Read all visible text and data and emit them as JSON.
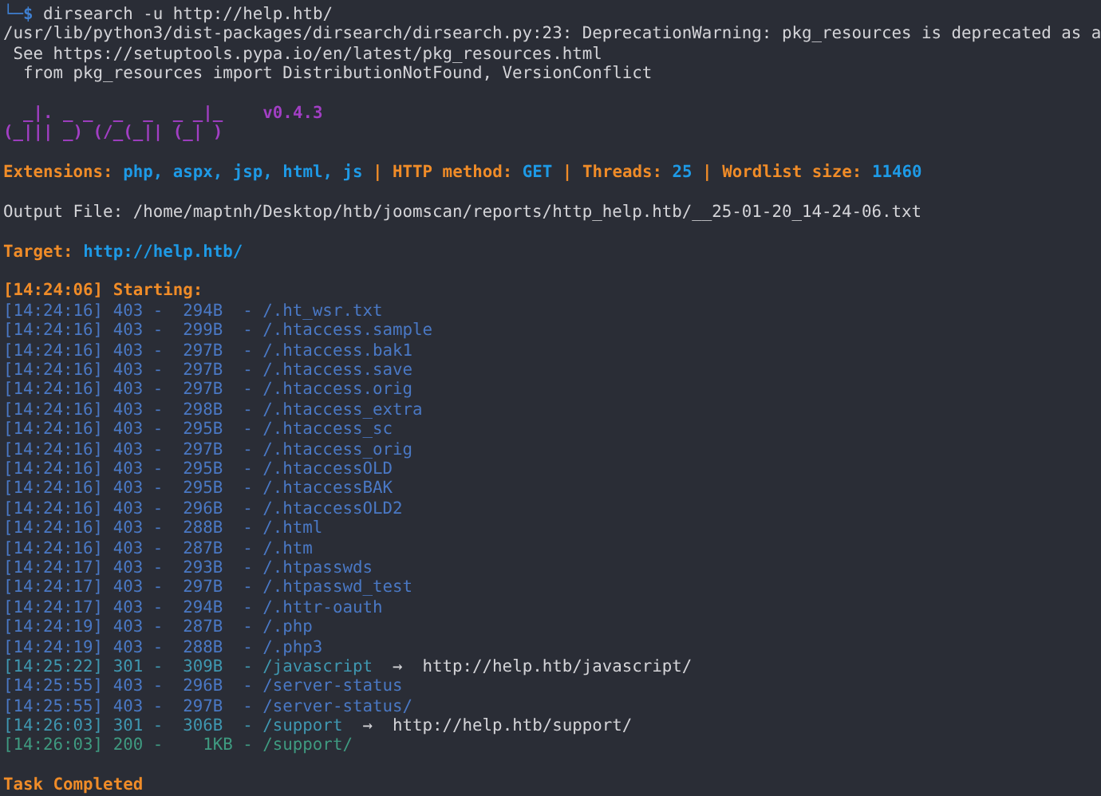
{
  "prompt": {
    "corner": "└─",
    "symbol": "$",
    "command": "dirsearch -u http://help.htb/"
  },
  "warning_lines": [
    "/usr/lib/python3/dist-packages/dirsearch/dirsearch.py:23: DeprecationWarning: pkg_resources is deprecated as a",
    " See https://setuptools.pypa.io/en/latest/pkg_resources.html",
    "  from pkg_resources import DistributionNotFound, VersionConflict"
  ],
  "banner": {
    "art": [
      "  _|. _ _  _  _  _ _|_",
      "(_||| _) (/_(_|| (_| )"
    ],
    "version": "v0.4.3"
  },
  "config": [
    {
      "kind": "label",
      "text": "Extensions:"
    },
    {
      "kind": "value",
      "text": "php, aspx, jsp, html, js"
    },
    {
      "kind": "separator",
      "text": "|"
    },
    {
      "kind": "label",
      "text": "HTTP method:"
    },
    {
      "kind": "value",
      "text": "GET"
    },
    {
      "kind": "separator",
      "text": "|"
    },
    {
      "kind": "label",
      "text": "Threads:"
    },
    {
      "kind": "value",
      "text": "25"
    },
    {
      "kind": "separator",
      "text": "|"
    },
    {
      "kind": "label",
      "text": "Wordlist size:"
    },
    {
      "kind": "value",
      "text": "11460"
    }
  ],
  "output_file": "Output File: /home/maptnh/Desktop/htb/joomscan/reports/http_help.htb/__25-01-20_14-24-06.txt",
  "target": {
    "label": "Target:",
    "value": "http://help.htb/"
  },
  "start": "[14:24:06] Starting:",
  "results": [
    {
      "line": "[14:24:16] 403 -  294B  - /.ht_wsr.txt",
      "color": "#4a78c4"
    },
    {
      "line": "[14:24:16] 403 -  299B  - /.htaccess.sample",
      "color": "#4a78c4"
    },
    {
      "line": "[14:24:16] 403 -  297B  - /.htaccess.bak1",
      "color": "#4a78c4"
    },
    {
      "line": "[14:24:16] 403 -  297B  - /.htaccess.save",
      "color": "#4a78c4"
    },
    {
      "line": "[14:24:16] 403 -  297B  - /.htaccess.orig",
      "color": "#4a78c4"
    },
    {
      "line": "[14:24:16] 403 -  298B  - /.htaccess_extra",
      "color": "#4a78c4"
    },
    {
      "line": "[14:24:16] 403 -  295B  - /.htaccess_sc",
      "color": "#4a78c4"
    },
    {
      "line": "[14:24:16] 403 -  297B  - /.htaccess_orig",
      "color": "#4a78c4"
    },
    {
      "line": "[14:24:16] 403 -  295B  - /.htaccessOLD",
      "color": "#4a78c4"
    },
    {
      "line": "[14:24:16] 403 -  295B  - /.htaccessBAK",
      "color": "#4a78c4"
    },
    {
      "line": "[14:24:16] 403 -  296B  - /.htaccessOLD2",
      "color": "#4a78c4"
    },
    {
      "line": "[14:24:16] 403 -  288B  - /.html",
      "color": "#4a78c4"
    },
    {
      "line": "[14:24:16] 403 -  287B  - /.htm",
      "color": "#4a78c4"
    },
    {
      "line": "[14:24:17] 403 -  293B  - /.htpasswds",
      "color": "#4a78c4"
    },
    {
      "line": "[14:24:17] 403 -  297B  - /.htpasswd_test",
      "color": "#4a78c4"
    },
    {
      "line": "[14:24:17] 403 -  294B  - /.httr-oauth",
      "color": "#4a78c4"
    },
    {
      "line": "[14:24:19] 403 -  287B  - /.php",
      "color": "#4a78c4"
    },
    {
      "line": "[14:24:19] 403 -  288B  - /.php3",
      "color": "#4a78c4"
    },
    {
      "line": "[14:25:22] 301 -  309B  - /javascript",
      "arrow": "→",
      "redirect": "http://help.htb/javascript/",
      "color": "#3f97b0"
    },
    {
      "line": "[14:25:55] 403 -  296B  - /server-status",
      "color": "#4a78c4"
    },
    {
      "line": "[14:25:55] 403 -  297B  - /server-status/",
      "color": "#4a78c4"
    },
    {
      "line": "[14:26:03] 301 -  306B  - /support",
      "arrow": "→",
      "redirect": "http://help.htb/support/",
      "color": "#3f97b0"
    },
    {
      "line": "[14:26:03] 200 -    1KB - /support/",
      "color": "#3f9a80"
    }
  ],
  "completion": "Task Completed"
}
